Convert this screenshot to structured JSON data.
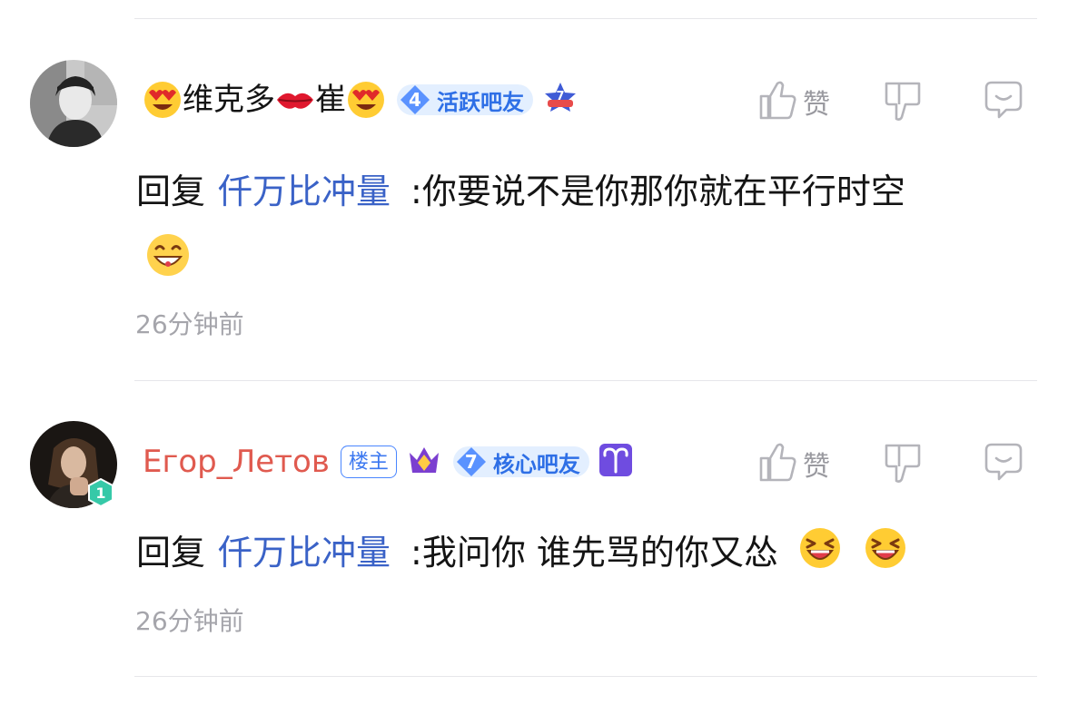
{
  "comments": [
    {
      "user": {
        "name_part1": "维克多",
        "name_part2": "崔"
      },
      "level_badge": {
        "level": "4",
        "label": "活跃吧友",
        "color": "#2e6fe6"
      },
      "star_badge": "7",
      "actions": {
        "like_label": "赞"
      },
      "reply": {
        "prefix": "回复",
        "target": "仟万比冲量",
        "text": ":你要说不是你那你就在平行时空"
      },
      "time": "26分钟前"
    },
    {
      "user": {
        "name": "Егор_Летов",
        "name_color": "#e05a4f"
      },
      "owner_tag": "楼主",
      "level_badge": {
        "level": "7",
        "label": "核心吧友",
        "color": "#2e6fe6"
      },
      "avatar_level": "1",
      "actions": {
        "like_label": "赞"
      },
      "reply": {
        "prefix": "回复",
        "target": "仟万比冲量",
        "text": ":我问你 谁先骂的你又怂"
      },
      "time": "26分钟前"
    }
  ]
}
